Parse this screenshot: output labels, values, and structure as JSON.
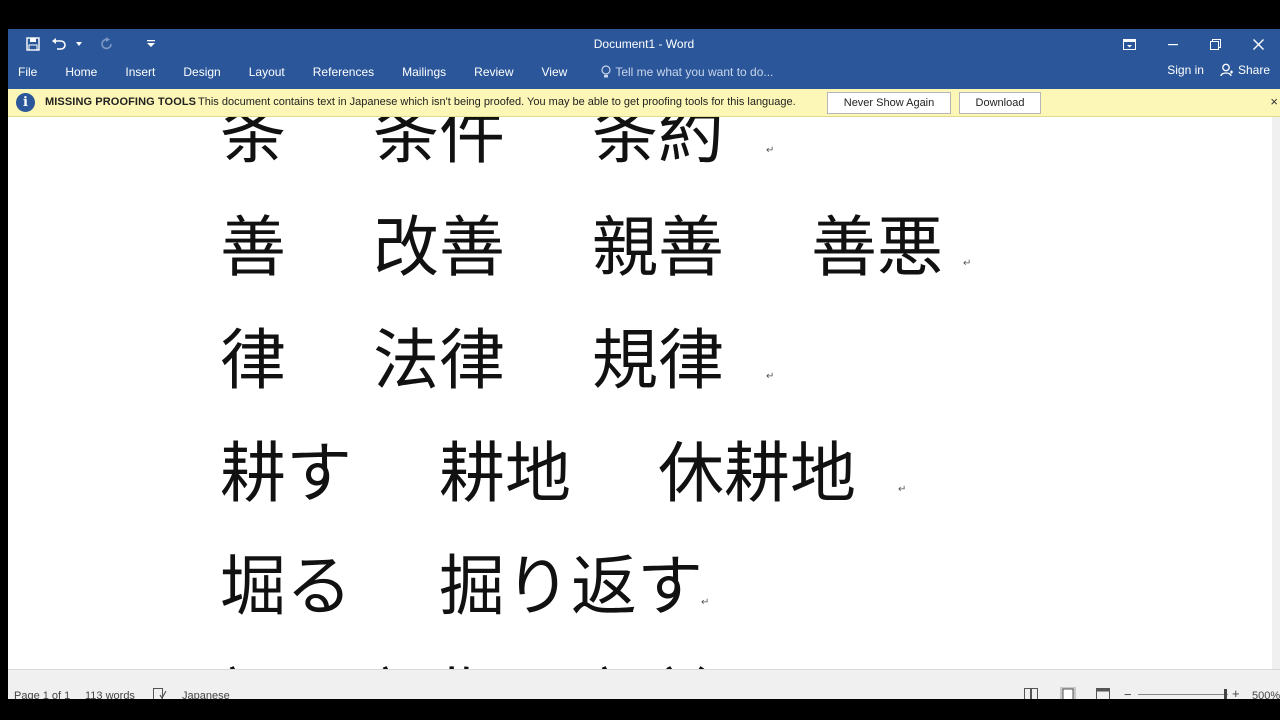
{
  "window": {
    "title": "Document1 - Word"
  },
  "ribbon": {
    "tabs": [
      "File",
      "Home",
      "Insert",
      "Design",
      "Layout",
      "References",
      "Mailings",
      "Review",
      "View"
    ],
    "tell_me": "Tell me what you want to do...",
    "sign_in": "Sign in",
    "share": "Share"
  },
  "message_bar": {
    "title": "MISSING PROOFING TOOLS",
    "text": "This document contains text in Japanese which isn't being proofed. You may be able to get proofing tools for this language.",
    "never_show_again": "Never Show Again",
    "download": "Download",
    "close": "×"
  },
  "document": {
    "lines": [
      [
        "条",
        "条件",
        "条約"
      ],
      [
        "善",
        "改善",
        "親善",
        "善悪"
      ],
      [
        "律",
        "法律",
        "規律"
      ],
      [
        "耕す",
        "耕地",
        "休耕地"
      ],
      [
        "堀る",
        "掘り返す"
      ],
      [
        "証",
        "証拠",
        "証論"
      ]
    ],
    "paragraph_mark": "↵"
  },
  "status": {
    "page": "Page 1 of 1",
    "words": "113 words",
    "language": "Japanese",
    "zoom": "500%"
  },
  "colors": {
    "accent": "#2b579a",
    "message_bg": "#fcf7b6"
  }
}
